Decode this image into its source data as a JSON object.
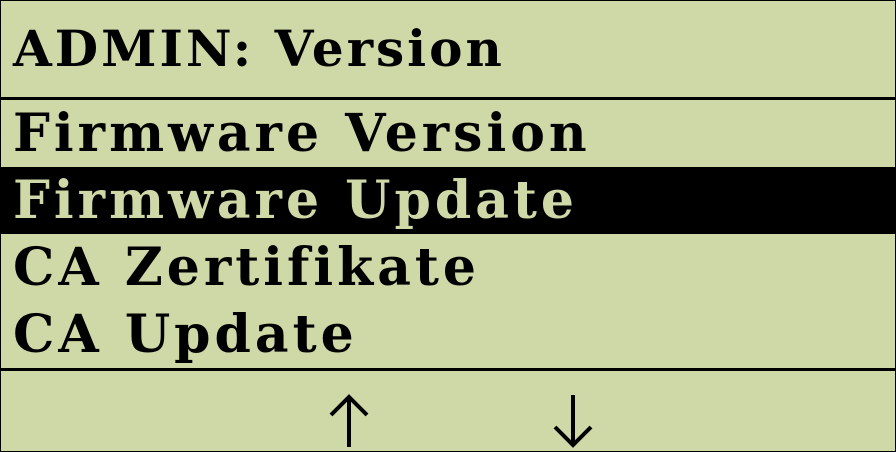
{
  "header": {
    "title": "ADMIN: Version"
  },
  "menu": {
    "items": [
      {
        "label": "Firmware Version",
        "selected": false
      },
      {
        "label": "Firmware Update",
        "selected": true
      },
      {
        "label": "CA Zertifikate",
        "selected": false
      },
      {
        "label": "CA Update",
        "selected": false
      }
    ]
  },
  "footer": {
    "up_icon": "arrow-up-icon",
    "down_icon": "arrow-down-icon"
  },
  "colors": {
    "background": "#cfd9a8",
    "foreground": "#000000",
    "selected_bg": "#000000",
    "selected_fg": "#cfd9a8"
  }
}
